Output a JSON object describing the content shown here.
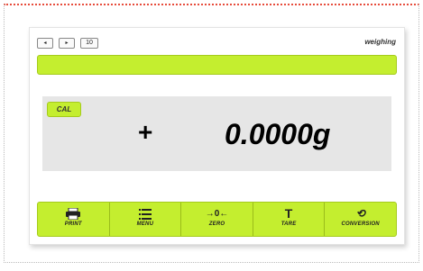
{
  "status": {
    "btn_back": "◂",
    "btn_forward": "▸",
    "btn_count": "10",
    "mode": "weighing"
  },
  "display": {
    "cal_label": "CAL",
    "sign": "+",
    "value": "0.0000g"
  },
  "toolbar": {
    "items": [
      {
        "label": "PRINT",
        "icon": "printer-icon"
      },
      {
        "label": "MENU",
        "icon": "menu-list-icon"
      },
      {
        "label": "ZERO",
        "icon": "zero-arrows-icon",
        "icon_text": "→0←"
      },
      {
        "label": "TARE",
        "icon": "tare-icon",
        "icon_text": "T"
      },
      {
        "label": "CONVERSION",
        "icon": "conversion-icon",
        "icon_text": "⟲"
      }
    ]
  },
  "colors": {
    "accent_green": "#c4ee2f",
    "panel_gray": "#e6e6e6"
  }
}
